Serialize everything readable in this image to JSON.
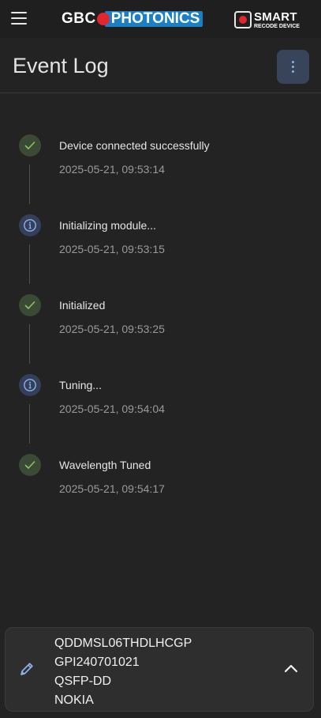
{
  "app": {
    "brand_left": "GBC",
    "brand_right": "PHOTONICS",
    "smart_title": "SMART",
    "smart_subtitle": "RECODE DEVICE"
  },
  "header": {
    "title": "Event Log"
  },
  "events": [
    {
      "status": "success",
      "icon": "check-icon",
      "message": "Device connected successfully",
      "timestamp": "2025-05-21, 09:53:14"
    },
    {
      "status": "info",
      "icon": "info-icon",
      "message": "Initializing module...",
      "timestamp": "2025-05-21, 09:53:15"
    },
    {
      "status": "success",
      "icon": "check-icon",
      "message": "Initialized",
      "timestamp": "2025-05-21, 09:53:25"
    },
    {
      "status": "info",
      "icon": "info-icon",
      "message": "Tuning...",
      "timestamp": "2025-05-21, 09:54:04"
    },
    {
      "status": "success",
      "icon": "check-icon",
      "message": "Wavelength Tuned",
      "timestamp": "2025-05-21, 09:54:17"
    }
  ],
  "device": {
    "part_number": "QDDMSL06THDLHCGP",
    "serial_number": "GPI240701021",
    "form_factor": "QSFP-DD",
    "vendor": "NOKIA"
  },
  "colors": {
    "background": "#232323",
    "success_icon": "#8fbf6a",
    "info_icon": "#8eb0e6",
    "brand_red": "#e3262d",
    "brand_blue": "#1a7fc4"
  }
}
